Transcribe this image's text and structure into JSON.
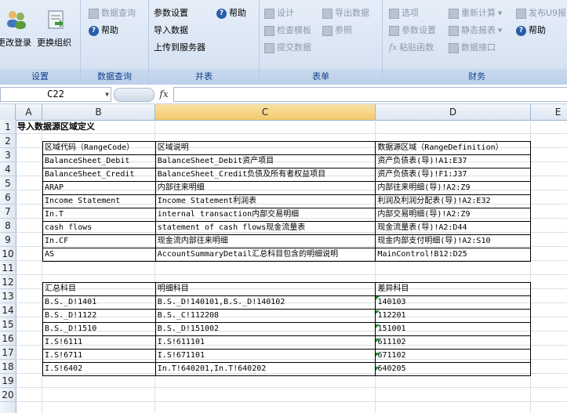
{
  "ribbon": {
    "settings": {
      "label": "设置",
      "btn_login": "更改登录",
      "btn_org": "更换组织"
    },
    "data_query": {
      "label": "数据查询",
      "btn_query": "数据查询",
      "btn_help": "帮助"
    },
    "merge": {
      "label": "并表",
      "btn_param": "参数设置",
      "btn_help": "帮助",
      "btn_import": "导入数据",
      "btn_upload": "上传到服务器"
    },
    "report": {
      "label": "表单",
      "btn_design": "设计",
      "btn_export": "导出数据",
      "btn_check": "检查模板",
      "btn_ref": "参照",
      "btn_submit": "提交数据"
    },
    "finance": {
      "label": "财务",
      "btn_options": "选项",
      "btn_recalc": "重新计算",
      "btn_publish": "发布U9报",
      "btn_param": "参数设置",
      "btn_static": "静态报表",
      "btn_help": "帮助",
      "btn_paste": "粘贴函数",
      "btn_interface": "数据接口"
    }
  },
  "formula_bar": {
    "cell_ref": "C22",
    "fx": "fx",
    "value": ""
  },
  "columns": [
    "A",
    "B",
    "C",
    "D",
    "E"
  ],
  "rows": [
    "1",
    "2",
    "3",
    "4",
    "5",
    "6",
    "7",
    "8",
    "9",
    "10",
    "11",
    "12",
    "13",
    "14",
    "15",
    "16",
    "17",
    "18",
    "19",
    "20"
  ],
  "sheet": {
    "title": "导入数据源区域定义",
    "table1": {
      "header": [
        "区域代码（RangeCode）",
        "区域说明",
        "数据源区域（RangeDefinition）"
      ],
      "rows": [
        [
          "BalanceSheet_Debit",
          "BalanceSheet_Debit资产项目",
          "资产负债表(导)!A1:E37"
        ],
        [
          "BalanceSheet_Credit",
          "BalanceSheet_Credit负债及所有者权益项目",
          "资产负债表(导)!F1:J37"
        ],
        [
          "ARAP",
          "内部往来明细",
          "内部往来明细(导)!A2:Z9"
        ],
        [
          "Income Statement",
          "Income Statement利润表",
          "利润及利润分配表(导)!A2:E32"
        ],
        [
          "In.T",
          "internal transaction内部交易明细",
          "内部交易明细(导)!A2:Z9"
        ],
        [
          "cash flows",
          "statement of cash flows现金流量表",
          "现金流量表(导)!A2:D44"
        ],
        [
          "In.CF",
          "现金流内部往来明细",
          "现金内部支付明细(导)!A2:S10"
        ],
        [
          "AS",
          "AccountSummaryDetail汇总科目包含的明细说明",
          "MainControl!B12:D25"
        ]
      ]
    },
    "table2": {
      "header": [
        "汇总科目",
        "明细科目",
        "差异科目"
      ],
      "rows": [
        [
          "B.S._D!1401",
          "B.S._D!140101,B.S._D!140102",
          "140103"
        ],
        [
          "B.S._D!1122",
          "B.S._C!112208",
          "112201"
        ],
        [
          "B.S._D!1510",
          "B.S._D!151002",
          "151001"
        ],
        [
          "I.S!6111",
          "I.S!611101",
          "611102"
        ],
        [
          "I.S!6711",
          "I.S!671101",
          "671102"
        ],
        [
          "I.S!6402",
          "In.T!640201,In.T!640202",
          "640205"
        ]
      ]
    }
  }
}
